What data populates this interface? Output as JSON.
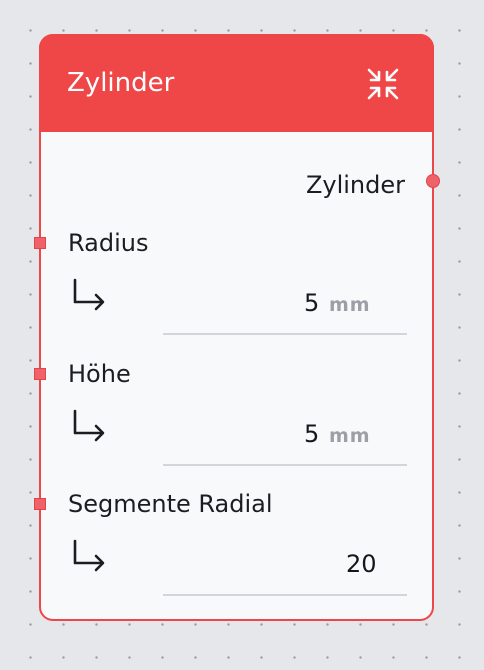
{
  "node": {
    "title": "Zylinder",
    "collapse_icon": "collapse-arrows-icon",
    "colors": {
      "header": "#ef4747",
      "port": "#f0626a",
      "body": "#f8f9fb",
      "canvas": "#e6e7ea"
    },
    "output": {
      "label": "Zylinder"
    },
    "params": [
      {
        "label": "Radius",
        "value": "5",
        "unit": "mm",
        "icon": "sub-arrow-icon"
      },
      {
        "label": "Höhe",
        "value": "5",
        "unit": "mm",
        "icon": "sub-arrow-icon"
      },
      {
        "label": "Segmente Radial",
        "value": "20",
        "unit": "",
        "icon": "sub-arrow-icon"
      }
    ]
  }
}
